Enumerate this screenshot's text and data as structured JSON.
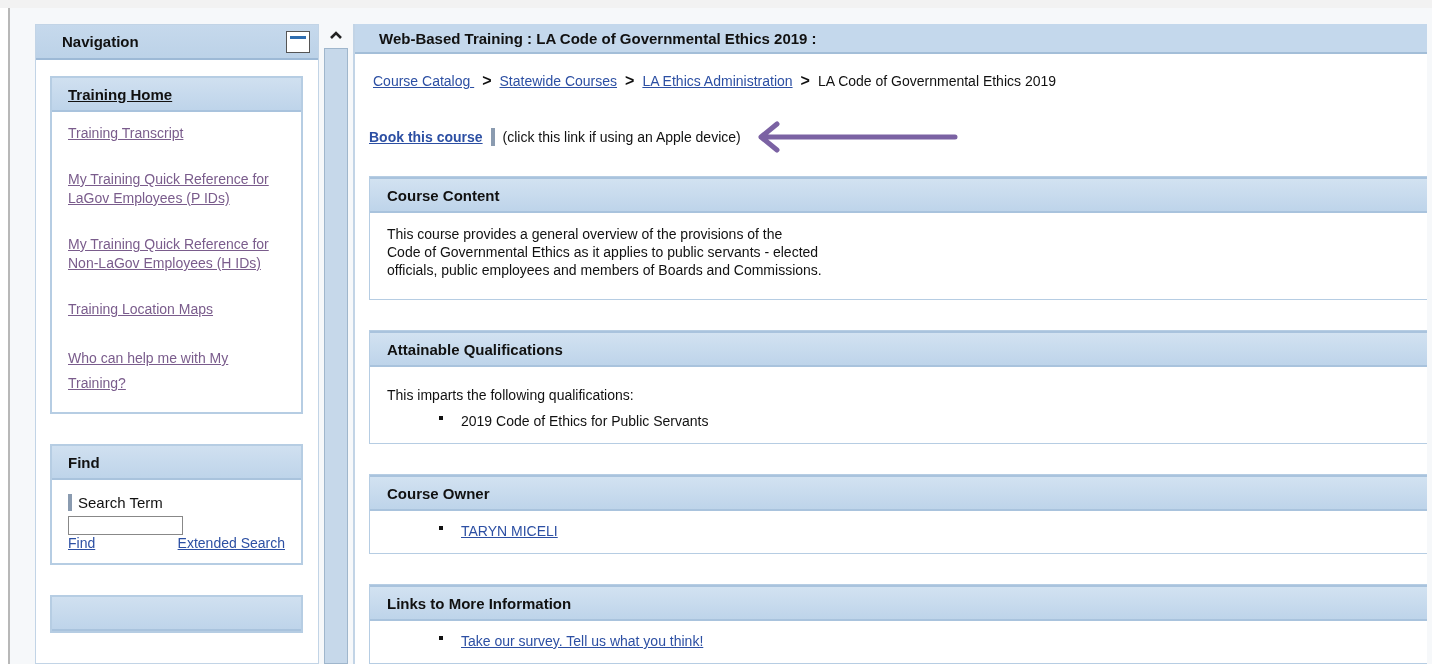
{
  "navigation": {
    "title": "Navigation",
    "sections": [
      {
        "title": "Training Home",
        "kind": "links",
        "links": [
          {
            "label": "Training Transcript",
            "visited": true
          },
          {
            "label": "My Training Quick Reference for LaGov Employees (P IDs)",
            "visited": true
          },
          {
            "label": "My Training Quick Reference for Non-LaGov Employees (H IDs)",
            "visited": true
          },
          {
            "label": "Training Location Maps",
            "visited": true
          },
          {
            "label": "Who can help me with My Training?",
            "visited": true
          }
        ]
      },
      {
        "title": "Find",
        "kind": "search",
        "field_label": "Search Term",
        "links": [
          {
            "label": "Find",
            "visited": false
          },
          {
            "label": "Extended Search",
            "visited": false
          }
        ]
      }
    ]
  },
  "main": {
    "title": "Web-Based Training : LA Code of Governmental Ethics 2019 :",
    "breadcrumb": [
      {
        "label": "Course Catalog ",
        "link": true
      },
      {
        "separator": ">",
        "label": "Statewide Courses",
        "link": true
      },
      {
        "separator": ">",
        "label": "LA Ethics Administration",
        "link": true
      },
      {
        "separator": ">",
        "label": "LA Code of Governmental Ethics 2019",
        "link": false
      }
    ],
    "book_link": "Book this course",
    "book_note": "(click this link if using an Apple device)",
    "sections": [
      {
        "title": "Course Content",
        "kind": "text",
        "lines": [
          "This course provides a general overview of the provisions of the",
          "Code of Governmental Ethics as it applies to public servants - elected",
          "officials, public employees and members of Boards and Commissions."
        ]
      },
      {
        "title": "Attainable Qualifications",
        "kind": "list",
        "intro": "This imparts the following qualifications:",
        "items": [
          {
            "label": "2019 Code of Ethics for Public Servants",
            "link": false
          }
        ]
      },
      {
        "title": "Course Owner",
        "kind": "list",
        "items": [
          {
            "label": "TARYN MICELI",
            "link": true
          }
        ]
      },
      {
        "title": "Links to More Information",
        "kind": "list",
        "items": [
          {
            "label": "Take our survey. Tell us what you think!",
            "link": true
          }
        ]
      }
    ]
  }
}
